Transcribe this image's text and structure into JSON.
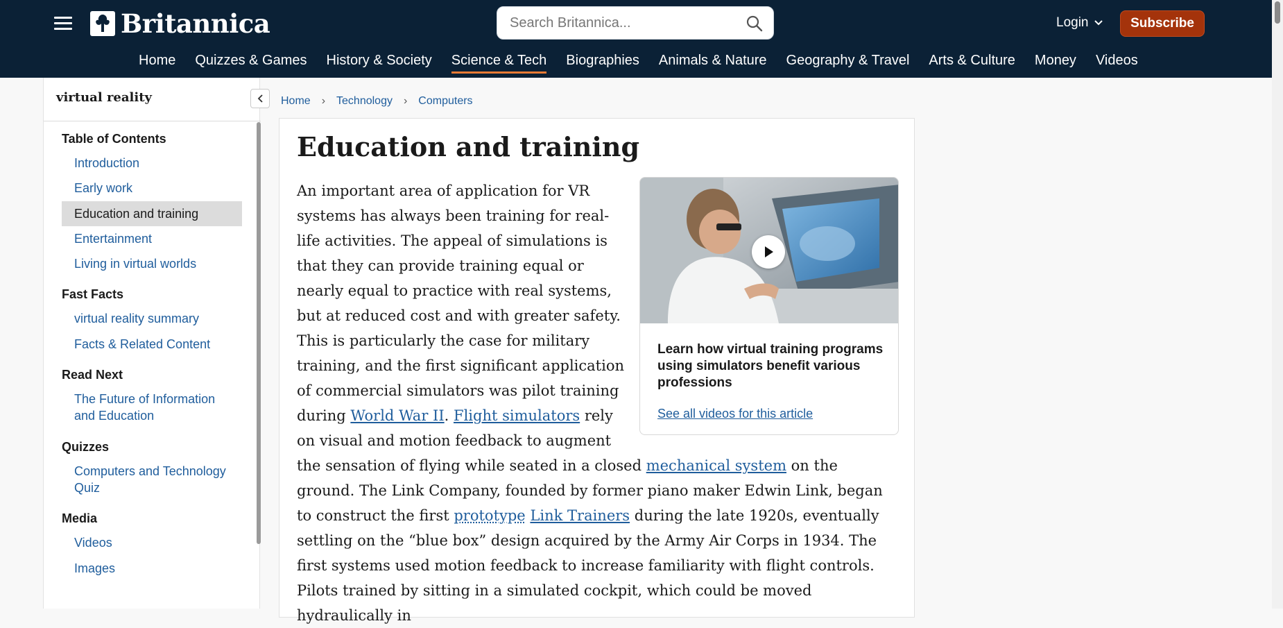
{
  "header": {
    "logo_text": "Britannica",
    "search_placeholder": "Search Britannica...",
    "login_label": "Login",
    "subscribe_label": "Subscribe",
    "nav": [
      "Home",
      "Quizzes & Games",
      "History & Society",
      "Science & Tech",
      "Biographies",
      "Animals & Nature",
      "Geography & Travel",
      "Arts & Culture",
      "Money",
      "Videos"
    ],
    "active_nav": "Science & Tech"
  },
  "sidebar": {
    "title": "virtual reality",
    "groups": [
      {
        "heading": "Table of Contents",
        "links": [
          "Introduction",
          "Early work",
          "Education and training",
          "Entertainment",
          "Living in virtual worlds"
        ],
        "active": "Education and training"
      },
      {
        "heading": "Fast Facts",
        "links": [
          "virtual reality summary",
          "Facts & Related Content"
        ]
      },
      {
        "heading": "Read Next",
        "links": [
          "The Future of Information and Education"
        ]
      },
      {
        "heading": "Quizzes",
        "links": [
          "Computers and Technology Quiz"
        ]
      },
      {
        "heading": "Media",
        "links": [
          "Videos",
          "Images"
        ]
      }
    ]
  },
  "breadcrumb": [
    "Home",
    "Technology",
    "Computers"
  ],
  "article": {
    "title": "Education and training",
    "video": {
      "caption": "Learn how virtual training programs using simulators benefit various professions",
      "link": "See all videos for this article"
    },
    "p1": "An important area of application for VR systems has always been training for real-life activities. The appeal of simulations is that they can provide training equal or nearly equal to practice with real systems, but at reduced cost and with greater safety. This is particularly the case for military training, and the first significant application of commercial simulators was pilot training during ",
    "link_ww2": "World War II",
    "t2": ". ",
    "link_flight": "Flight simulators",
    "t3": " rely on visual and motion feedback to augment the sensation of flying while seated in a closed ",
    "link_mech": "mechanical system",
    "t4": " on the ground. The Link Company, founded by former piano maker Edwin Link, began to construct the first ",
    "link_proto": "prototype",
    "t5": " ",
    "link_trainers": "Link Trainers",
    "t6": " during the late 1920s, eventually settling on the “blue box” design acquired by the Army Air Corps in 1934. The first systems used motion feedback to increase familiarity with flight controls. Pilots trained by sitting in a simulated cockpit, which could be moved hydraulically in"
  },
  "colors": {
    "header_bg": "#0b2136",
    "accent": "#e87a35",
    "subscribe_bg": "#a4330b",
    "link": "#1f5d9c"
  }
}
